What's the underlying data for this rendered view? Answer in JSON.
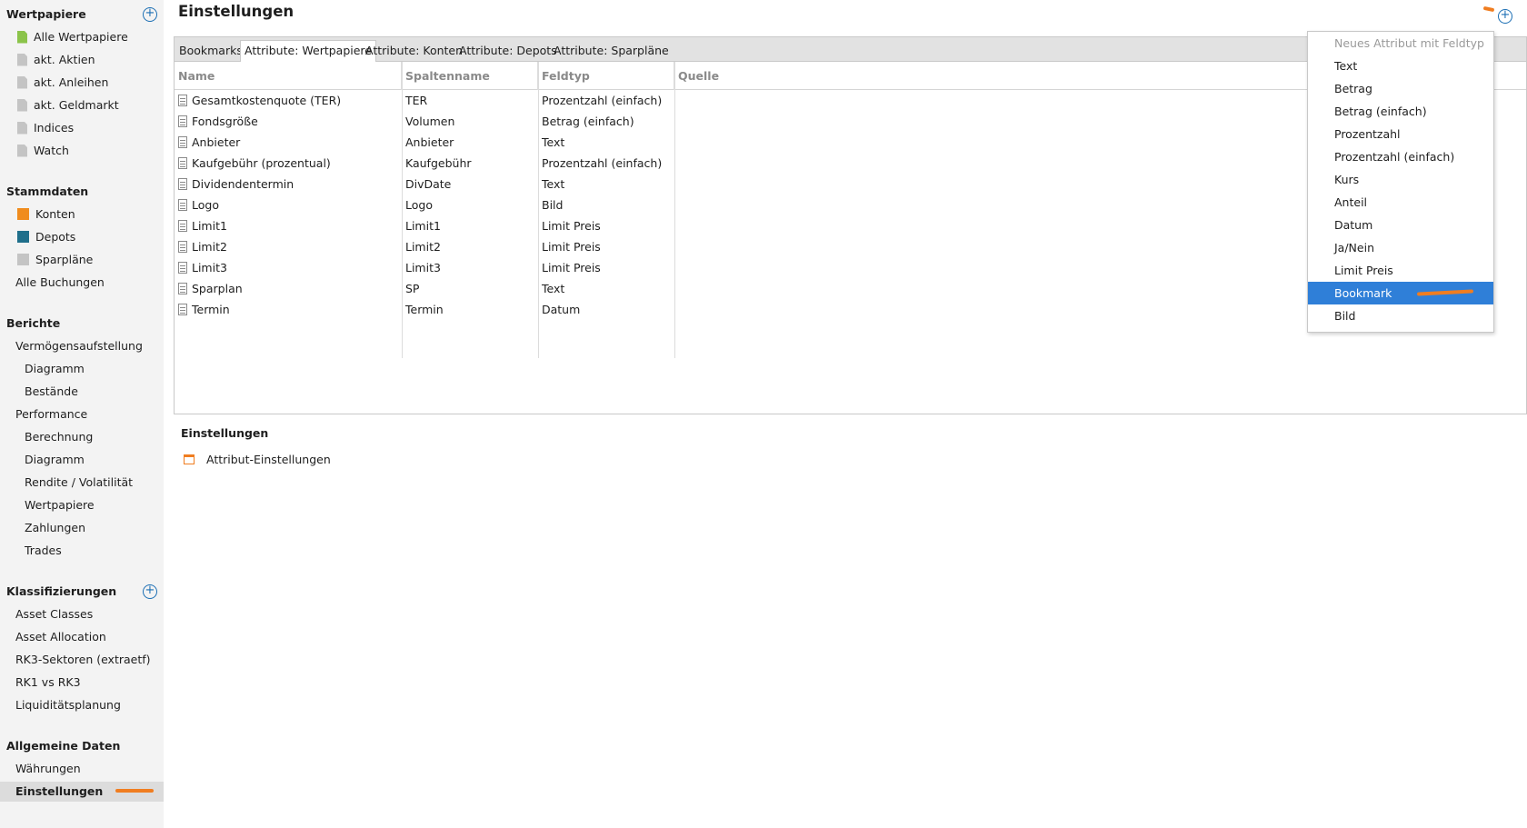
{
  "sidebar": {
    "wertpapiere": {
      "title": "Wertpapiere",
      "items": [
        "Alle Wertpapiere",
        "akt. Aktien",
        "akt. Anleihen",
        "akt. Geldmarkt",
        "Indices",
        "Watch"
      ]
    },
    "stammdaten": {
      "title": "Stammdaten",
      "items": [
        "Konten",
        "Depots",
        "Sparpläne",
        "Alle Buchungen"
      ]
    },
    "berichte": {
      "title": "Berichte",
      "items": [
        "Vermögensaufstellung",
        "Diagramm",
        "Bestände",
        "Performance",
        "Berechnung",
        "Diagramm",
        "Rendite / Volatilität",
        "Wertpapiere",
        "Zahlungen",
        "Trades"
      ]
    },
    "klassifizierungen": {
      "title": "Klassifizierungen",
      "items": [
        "Asset Classes",
        "Asset Allocation",
        "RK3-Sektoren (extraetf)",
        "RK1 vs RK3",
        "Liquiditätsplanung"
      ]
    },
    "allgemein": {
      "title": "Allgemeine Daten",
      "items": [
        "Währungen",
        "Einstellungen"
      ]
    },
    "add_symbol": "+"
  },
  "main": {
    "title": "Einstellungen",
    "add_symbol": "+",
    "tabs": [
      "Bookmarks",
      "Attribute: Wertpapiere",
      "Attribute: Konten",
      "Attribute: Depots",
      "Attribute: Sparpläne"
    ],
    "columns": [
      "Name",
      "Spaltenname",
      "Feldtyp",
      "Quelle"
    ],
    "rows": [
      {
        "name": "Gesamtkostenquote (TER)",
        "column": "TER",
        "type": "Prozentzahl (einfach)"
      },
      {
        "name": "Fondsgröße",
        "column": "Volumen",
        "type": "Betrag (einfach)"
      },
      {
        "name": "Anbieter",
        "column": "Anbieter",
        "type": "Text"
      },
      {
        "name": "Kaufgebühr (prozentual)",
        "column": "Kaufgebühr",
        "type": "Prozentzahl (einfach)"
      },
      {
        "name": "Dividendentermin",
        "column": "DivDate",
        "type": "Text"
      },
      {
        "name": "Logo",
        "column": "Logo",
        "type": "Bild"
      },
      {
        "name": "Limit1",
        "column": "Limit1",
        "type": "Limit Preis"
      },
      {
        "name": "Limit2",
        "column": "Limit2",
        "type": "Limit Preis"
      },
      {
        "name": "Limit3",
        "column": "Limit3",
        "type": "Limit Preis"
      },
      {
        "name": "Sparplan",
        "column": "SP",
        "type": "Text"
      },
      {
        "name": "Termin",
        "column": "Termin",
        "type": "Datum"
      }
    ],
    "settings_section": {
      "title": "Einstellungen",
      "item": "Attribut-Einstellungen"
    }
  },
  "menu": {
    "header": "Neues Attribut mit Feldtyp",
    "items": [
      "Text",
      "Betrag",
      "Betrag (einfach)",
      "Prozentzahl",
      "Prozentzahl (einfach)",
      "Kurs",
      "Anteil",
      "Datum",
      "Ja/Nein",
      "Limit Preis",
      "Bookmark",
      "Bild"
    ],
    "highlighted": "Bookmark"
  },
  "colors": {
    "accent_blue": "#2f7fd8",
    "annotation_orange": "#f07d20",
    "sidebar_bg": "#f3f3f3",
    "konten_icon": "#f08c1e",
    "depots_icon": "#1f6f8b",
    "wertpapiere_icon": "#8bc34a",
    "doc_icon_gray": "#c4c4c4"
  }
}
